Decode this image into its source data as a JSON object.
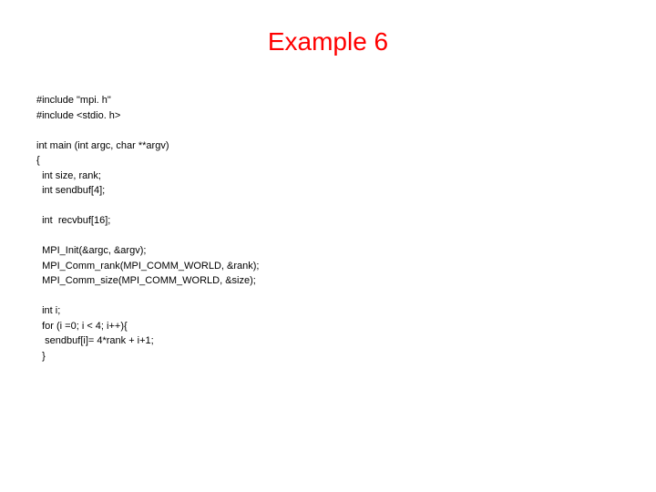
{
  "title": "Example 6",
  "code": {
    "line1": "#include \"mpi. h\"",
    "line2": "#include <stdio. h>",
    "line3": "int main (int argc, char **argv)",
    "line4": "{",
    "line5": "  int size, rank;",
    "line6": "  int sendbuf[4];",
    "line7": "  int  recvbuf[16];",
    "line8": "  MPI_Init(&argc, &argv);",
    "line9": "  MPI_Comm_rank(MPI_COMM_WORLD, &rank);",
    "line10": "  MPI_Comm_size(MPI_COMM_WORLD, &size);",
    "line11": "  int i;",
    "line12": "  for (i =0; i < 4; i++){",
    "line13": "   sendbuf[i]= 4*rank + i+1;",
    "line14": "  }"
  }
}
